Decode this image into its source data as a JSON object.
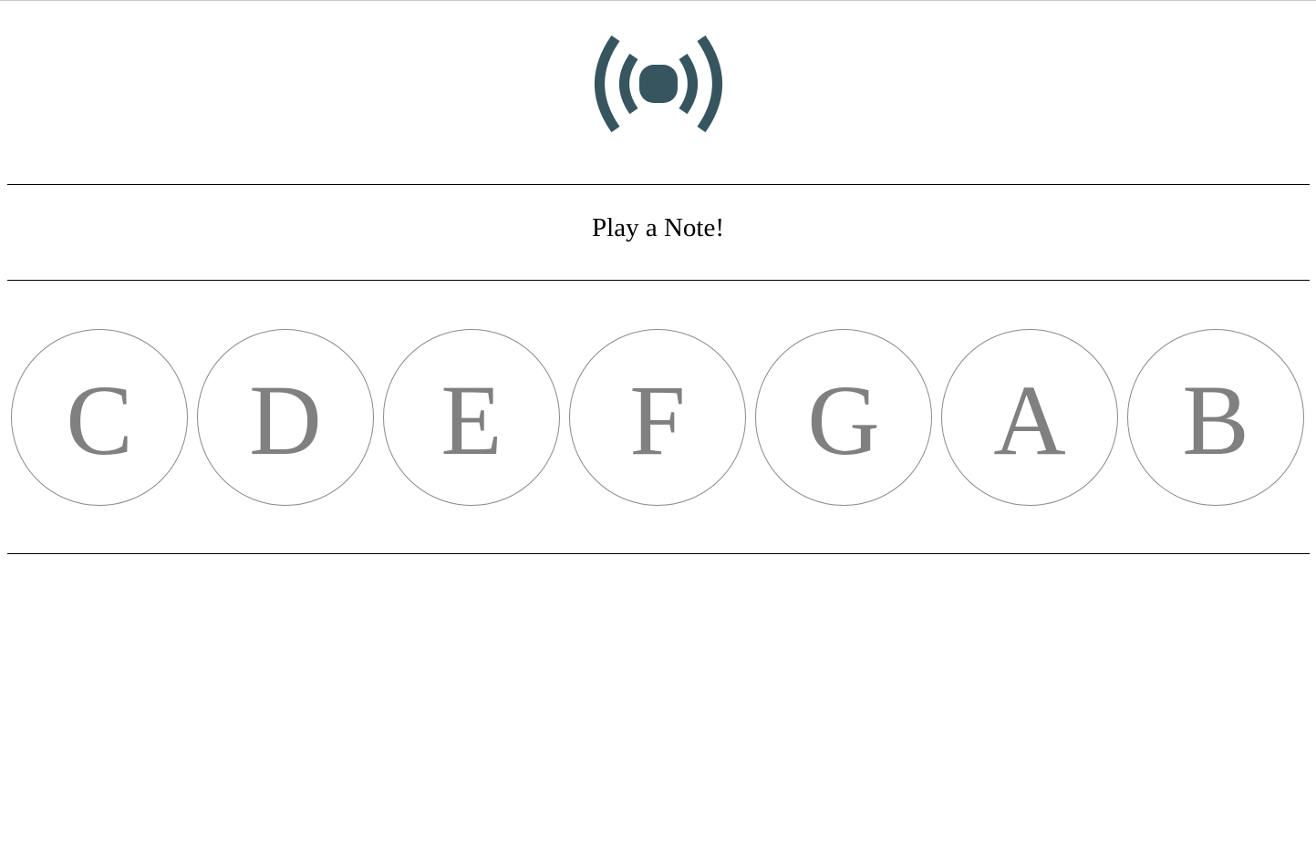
{
  "app": {
    "icon": "broadcast-icon",
    "icon_color": "#36555f"
  },
  "prompt": {
    "text": "Play a Note!"
  },
  "notes": [
    {
      "label": "C"
    },
    {
      "label": "D"
    },
    {
      "label": "E"
    },
    {
      "label": "F"
    },
    {
      "label": "G"
    },
    {
      "label": "A"
    },
    {
      "label": "B"
    }
  ],
  "colors": {
    "note_text": "#808080",
    "note_border": "#8a8a8a",
    "rule": "#000000"
  }
}
